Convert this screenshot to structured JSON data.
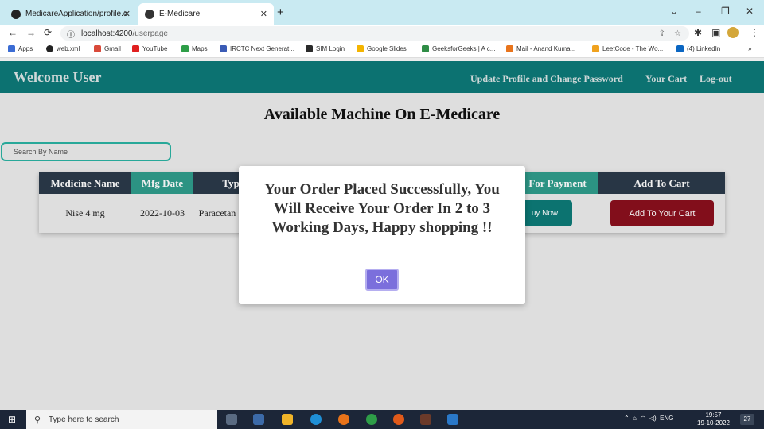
{
  "browser": {
    "tabs": [
      {
        "label": "MedicareApplication/profile.com",
        "active": false
      },
      {
        "label": "E-Medicare",
        "active": true
      }
    ],
    "url_host": "localhost:4200",
    "url_path": "/userpage",
    "bookmarks": [
      "Apps",
      "web.xml",
      "Gmail",
      "YouTube",
      "Maps",
      "IRCTC Next Generat...",
      "SIM Login",
      "Google Slides",
      "GeeksforGeeks | A c...",
      "Mail - Anand Kuma...",
      "LeetCode - The Wo...",
      "(4) LinkedIn"
    ],
    "more": "»"
  },
  "header": {
    "welcome": "Welcome User",
    "links": [
      "Update Profile and Change Password",
      "Your Cart",
      "Log-out"
    ]
  },
  "main": {
    "title": "Available Machine On E-Medicare",
    "search_placeholder": "Search By Name",
    "table": {
      "headers": [
        "Medicine Name",
        "Mfg Date",
        "Type",
        "For Payment",
        "Add To Cart"
      ],
      "row": {
        "name": "Nise 4 mg",
        "mfg": "2022-10-03",
        "type": "Paracetan",
        "buy": "uy Now",
        "cart": "Add To Your Cart"
      }
    }
  },
  "modal": {
    "message": "Your Order Placed Successfully, You Will Receive Your Order In 2 to 3 Working Days, Happy shopping !!",
    "ok": "OK"
  },
  "taskbar": {
    "search": "Type here to search",
    "tray": "ENG",
    "time": "19:57",
    "date": "19-10-2022",
    "notif": "27"
  },
  "colors": {
    "header": "#0c7271",
    "accent": "#2f9d8c",
    "table_header": "#2b3a4a",
    "cart": "#8b0f1d",
    "ok": "#7b6fdc"
  }
}
